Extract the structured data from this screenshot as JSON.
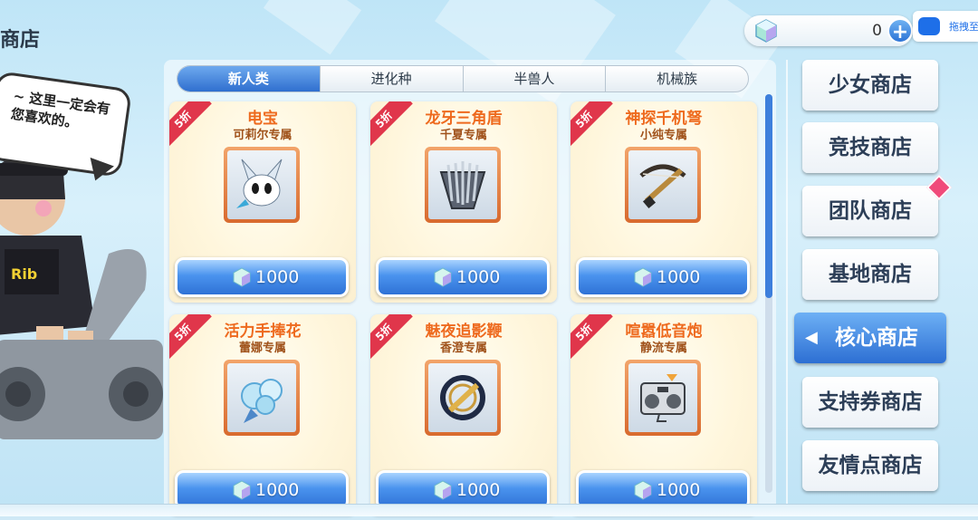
{
  "header": {
    "title": "商店"
  },
  "speech_bubble": {
    "text": "~ 这里一定会有您喜欢的。"
  },
  "currency": {
    "amount": "0",
    "plus": "+"
  },
  "corner_badge": {
    "text": "拖拽至"
  },
  "tabs": [
    {
      "label": "新人类",
      "active": true
    },
    {
      "label": "进化种",
      "active": false
    },
    {
      "label": "半兽人",
      "active": false
    },
    {
      "label": "机械族",
      "active": false
    }
  ],
  "items": [
    {
      "discount": "5折",
      "name": "电宝",
      "owner": "可莉尔专属",
      "price": "1000",
      "icon": "rabbit-spirit-icon"
    },
    {
      "discount": "5折",
      "name": "龙牙三角盾",
      "owner": "千夏专属",
      "price": "1000",
      "icon": "spiked-shield-icon"
    },
    {
      "discount": "5折",
      "name": "神探千机弩",
      "owner": "小纯专属",
      "price": "1000",
      "icon": "crossbow-icon"
    },
    {
      "discount": "5折",
      "name": "活力手捧花",
      "owner": "蕾娜专属",
      "price": "1000",
      "icon": "bouquet-icon"
    },
    {
      "discount": "5折",
      "name": "魅夜追影鞭",
      "owner": "香澄专属",
      "price": "1000",
      "icon": "whip-icon"
    },
    {
      "discount": "5折",
      "name": "喧嚣低音炮",
      "owner": "静流专属",
      "price": "1000",
      "icon": "boombox-icon"
    }
  ],
  "nav": [
    {
      "label": "少女商店",
      "active": false
    },
    {
      "label": "竞技商店",
      "active": false
    },
    {
      "label": "团队商店",
      "active": false,
      "badge": true
    },
    {
      "label": "基地商店",
      "active": false
    },
    {
      "label": "核心商店",
      "active": true
    },
    {
      "label": "支持券商店",
      "active": false
    },
    {
      "label": "友情点商店",
      "active": false
    }
  ],
  "colors": {
    "accent": "#2f6fcf",
    "discount": "#e0364b",
    "item_name": "#ee6a1e"
  }
}
